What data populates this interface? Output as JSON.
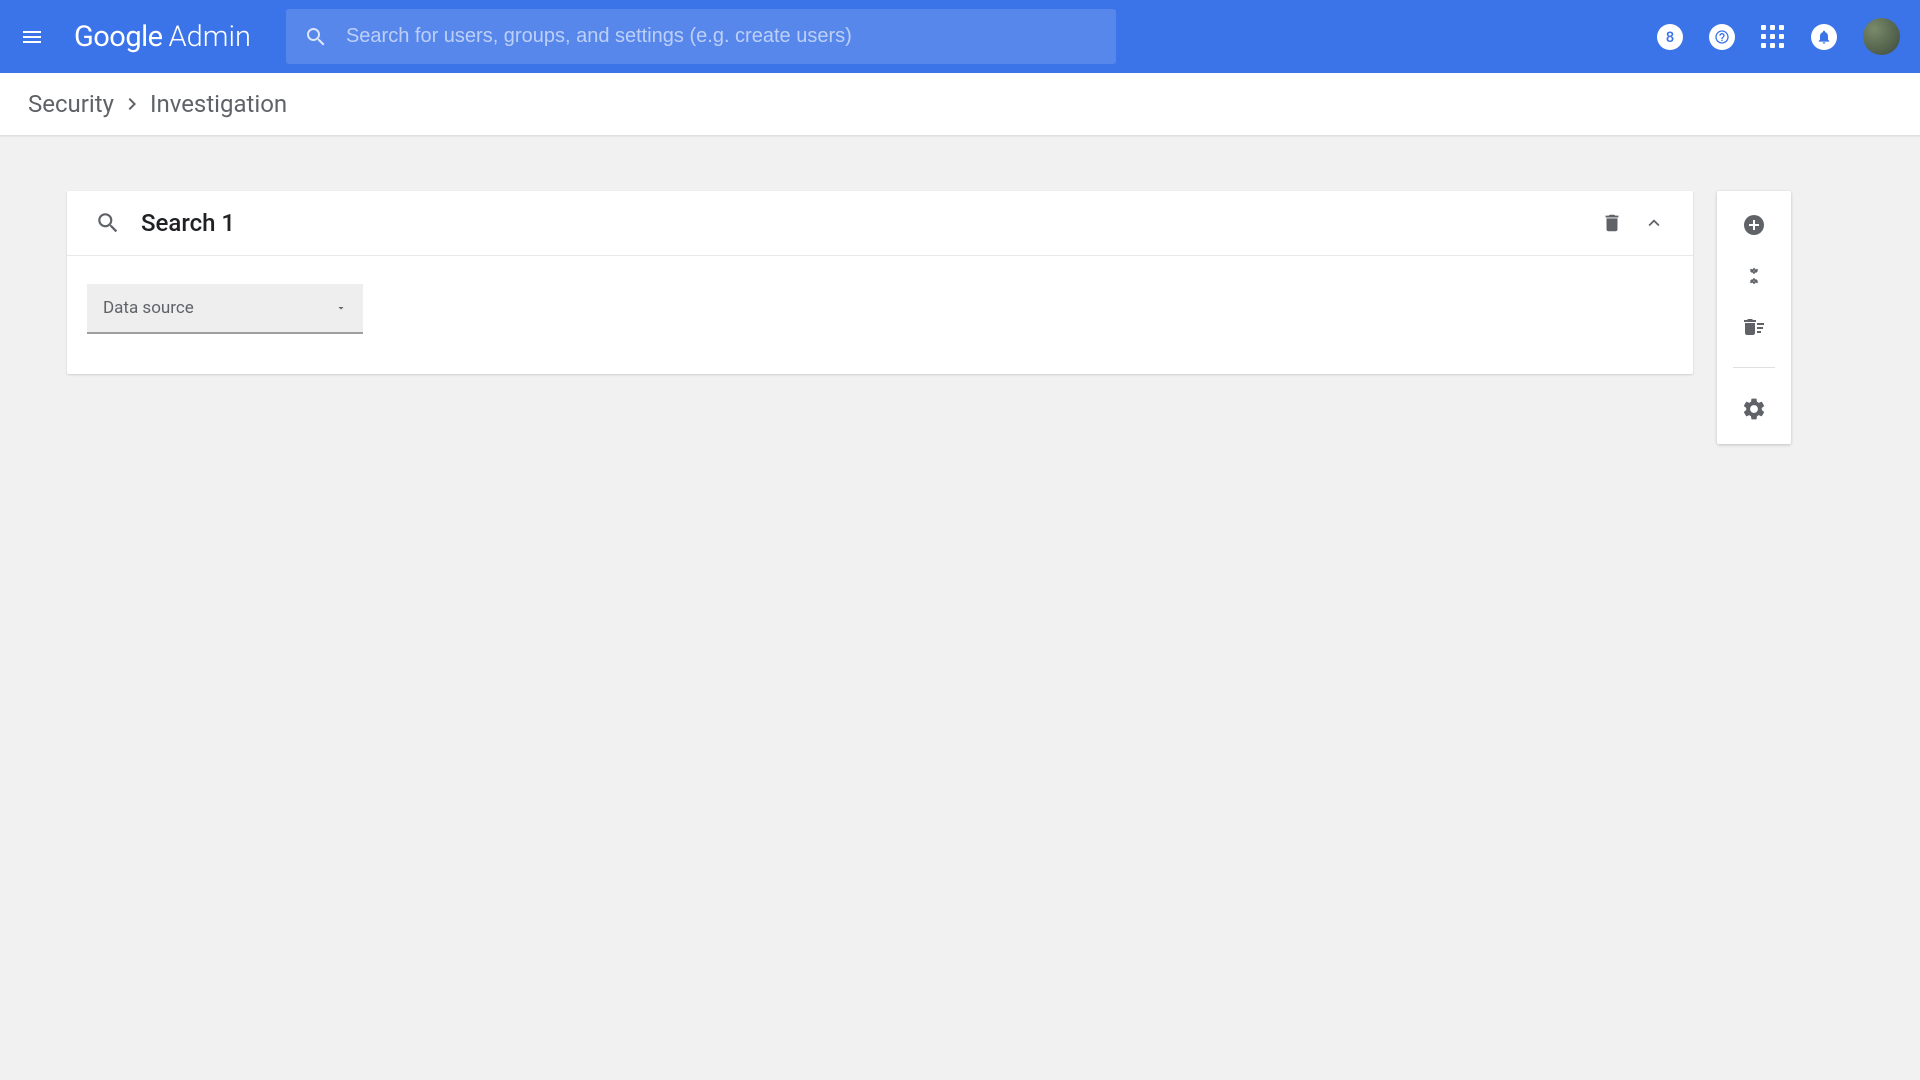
{
  "header": {
    "logo_google": "Google",
    "logo_admin": "Admin",
    "search_placeholder": "Search for users, groups, and settings (e.g. create users)",
    "account_badge": "8"
  },
  "breadcrumb": {
    "items": [
      "Security",
      "Investigation"
    ]
  },
  "search_card": {
    "title": "Search 1",
    "dropdown_label": "Data source"
  },
  "icons": {
    "menu": "menu-icon",
    "search": "search-icon",
    "help": "help-icon",
    "apps": "apps-icon",
    "notifications": "notifications-icon",
    "delete": "delete-icon",
    "collapse": "collapse-icon",
    "add": "add-icon",
    "collapse_all": "collapse-all-icon",
    "clear_all": "clear-all-icon",
    "settings": "settings-icon"
  }
}
